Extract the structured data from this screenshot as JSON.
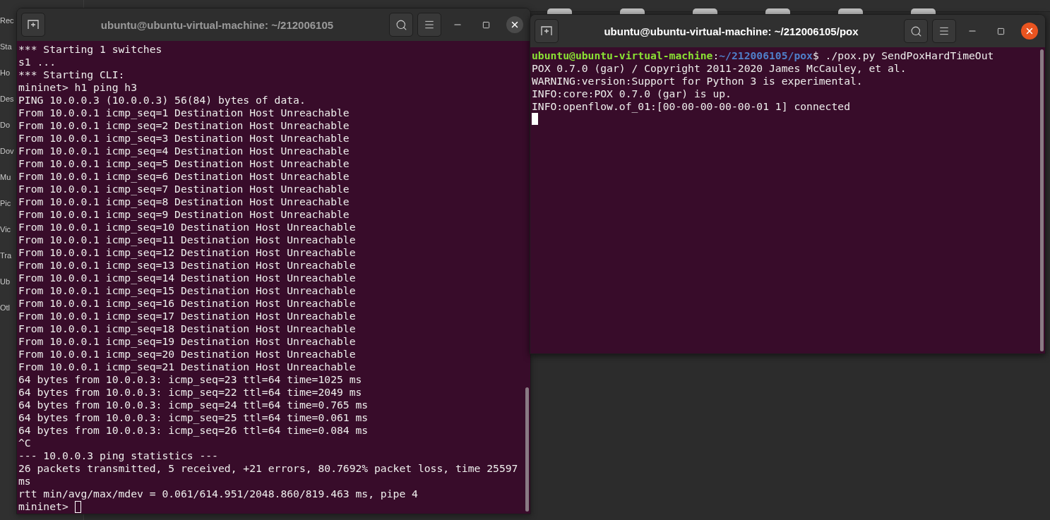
{
  "file_manager": {
    "sidebar_items": [
      "Rec",
      "Sta",
      "Ho",
      "Des",
      "Do",
      "Dov",
      "Mu",
      "Pic",
      "Vic",
      "Tra",
      "Ub",
      "Otl"
    ]
  },
  "terminals": [
    {
      "title": "ubuntu@ubuntu-virtual-machine: ~/212006105",
      "active": false,
      "cursor_focused": false,
      "input_prompt": "mininet>",
      "lines": [
        "*** Starting 1 switches",
        "s1 ...",
        "*** Starting CLI:",
        "mininet> h1 ping h3",
        "PING 10.0.0.3 (10.0.0.3) 56(84) bytes of data.",
        "From 10.0.0.1 icmp_seq=1 Destination Host Unreachable",
        "From 10.0.0.1 icmp_seq=2 Destination Host Unreachable",
        "From 10.0.0.1 icmp_seq=3 Destination Host Unreachable",
        "From 10.0.0.1 icmp_seq=4 Destination Host Unreachable",
        "From 10.0.0.1 icmp_seq=5 Destination Host Unreachable",
        "From 10.0.0.1 icmp_seq=6 Destination Host Unreachable",
        "From 10.0.0.1 icmp_seq=7 Destination Host Unreachable",
        "From 10.0.0.1 icmp_seq=8 Destination Host Unreachable",
        "From 10.0.0.1 icmp_seq=9 Destination Host Unreachable",
        "From 10.0.0.1 icmp_seq=10 Destination Host Unreachable",
        "From 10.0.0.1 icmp_seq=11 Destination Host Unreachable",
        "From 10.0.0.1 icmp_seq=12 Destination Host Unreachable",
        "From 10.0.0.1 icmp_seq=13 Destination Host Unreachable",
        "From 10.0.0.1 icmp_seq=14 Destination Host Unreachable",
        "From 10.0.0.1 icmp_seq=15 Destination Host Unreachable",
        "From 10.0.0.1 icmp_seq=16 Destination Host Unreachable",
        "From 10.0.0.1 icmp_seq=17 Destination Host Unreachable",
        "From 10.0.0.1 icmp_seq=18 Destination Host Unreachable",
        "From 10.0.0.1 icmp_seq=19 Destination Host Unreachable",
        "From 10.0.0.1 icmp_seq=20 Destination Host Unreachable",
        "From 10.0.0.1 icmp_seq=21 Destination Host Unreachable",
        "64 bytes from 10.0.0.3: icmp_seq=23 ttl=64 time=1025 ms",
        "64 bytes from 10.0.0.3: icmp_seq=22 ttl=64 time=2049 ms",
        "64 bytes from 10.0.0.3: icmp_seq=24 ttl=64 time=0.765 ms",
        "64 bytes from 10.0.0.3: icmp_seq=25 ttl=64 time=0.061 ms",
        "64 bytes from 10.0.0.3: icmp_seq=26 ttl=64 time=0.084 ms",
        "^C",
        "--- 10.0.0.3 ping statistics ---",
        "26 packets transmitted, 5 received, +21 errors, 80.7692% packet loss, time 25597 ms",
        "rtt min/avg/max/mdev = 0.061/614.951/2048.860/819.463 ms, pipe 4"
      ]
    },
    {
      "title": "ubuntu@ubuntu-virtual-machine: ~/212006105/pox",
      "active": true,
      "cursor_focused": true,
      "prompt": [
        {
          "kind": "user",
          "text": "ubuntu@ubuntu-virtual-machine"
        },
        {
          "kind": "plain",
          "text": ":"
        },
        {
          "kind": "path",
          "text": "~/212006105/pox"
        },
        {
          "kind": "plain",
          "text": "$ ./pox.py SendPoxHardTimeOut"
        }
      ],
      "lines": [
        "POX 0.7.0 (gar) / Copyright 2011-2020 James McCauley, et al.",
        "WARNING:version:Support for Python 3 is experimental.",
        "INFO:core:POX 0.7.0 (gar) is up.",
        "INFO:openflow.of_01:[00-00-00-00-00-01 1] connected"
      ]
    }
  ]
}
